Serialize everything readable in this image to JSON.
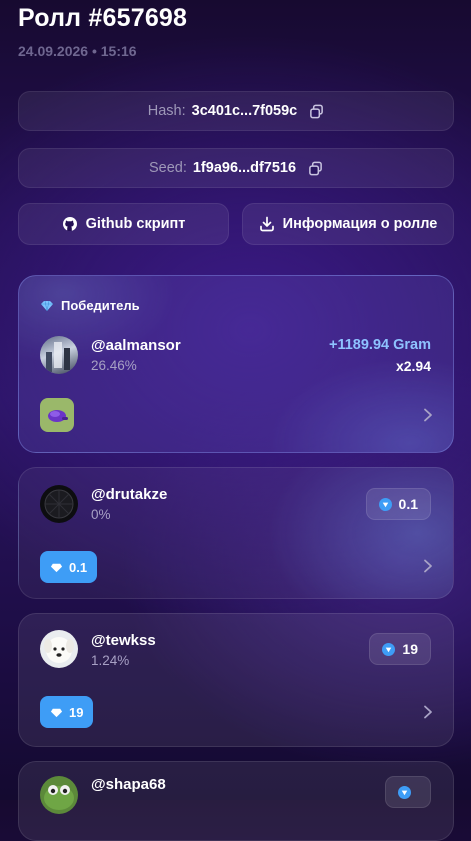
{
  "header": {
    "title": "Ролл #657698",
    "subtitle": "24.09.2026 • 15:16"
  },
  "hash": {
    "label": "Hash:",
    "value": "3c401c...7f059c"
  },
  "seed": {
    "label": "Seed:",
    "value": "1f9a96...df7516"
  },
  "buttons": {
    "github": "Github скрипт",
    "info": "Информация о ролле"
  },
  "winner": {
    "label": "Победитель",
    "username": "@aalmansor",
    "percent": "26.46%",
    "amount": "+1189.94 Gram",
    "multiplier": "x2.94"
  },
  "players": [
    {
      "username": "@drutakze",
      "percent": "0%",
      "bet": "0.1",
      "item_value": "0.1"
    },
    {
      "username": "@tewkss",
      "percent": "1.24%",
      "bet": "19",
      "item_value": "19"
    },
    {
      "username": "@shapa68",
      "percent": "",
      "bet": "",
      "item_value": ""
    }
  ],
  "colors": {
    "accent": "#3e9df6",
    "amount": "#8ec2ff",
    "background": "#241054"
  },
  "icons": [
    "copy-icon",
    "github-icon",
    "download-icon",
    "diamond-icon",
    "chevron-right-icon"
  ]
}
